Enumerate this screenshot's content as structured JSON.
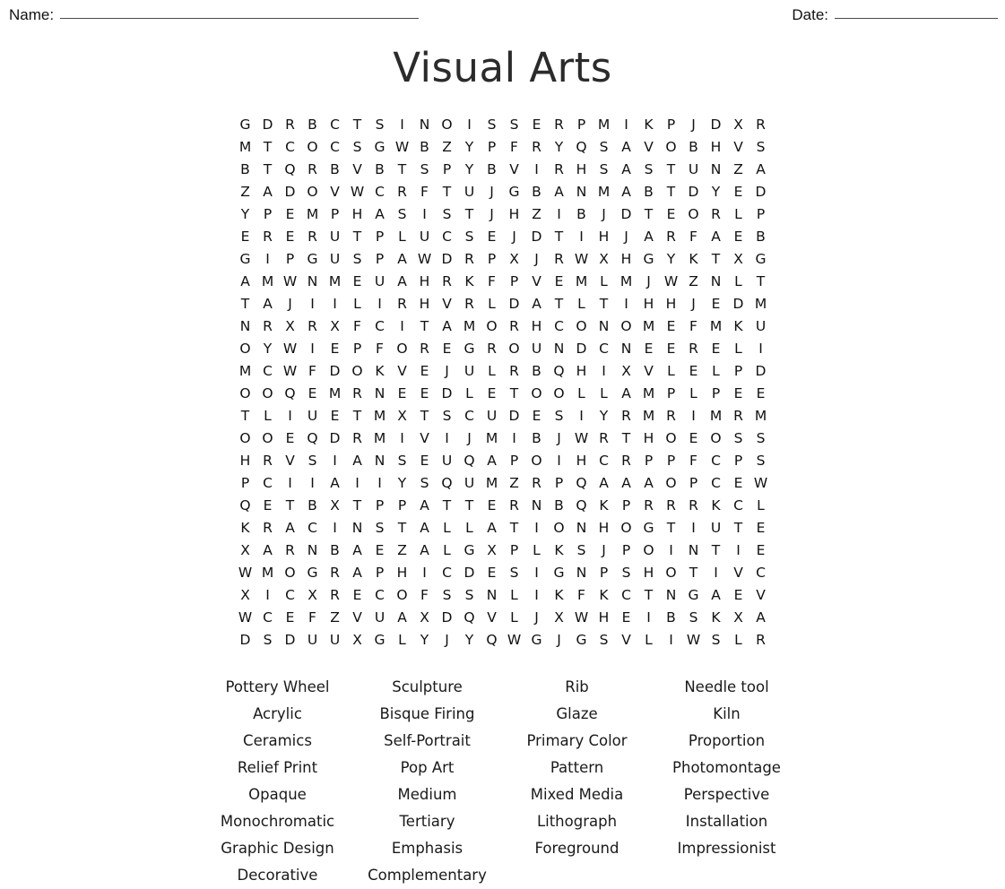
{
  "header": {
    "name_label": "Name:",
    "date_label": "Date:"
  },
  "title": "Visual Arts",
  "grid": {
    "columns": 24,
    "rows": 24,
    "letters": [
      [
        "G",
        "D",
        "R",
        "B",
        "C",
        "T",
        "S",
        "I",
        "N",
        "O",
        "I",
        "S",
        "S",
        "E",
        "R",
        "P",
        "M",
        "I",
        "K",
        "P",
        "J",
        "D",
        "X",
        "R"
      ],
      [
        "M",
        "T",
        "C",
        "O",
        "C",
        "S",
        "G",
        "W",
        "B",
        "Z",
        "Y",
        "P",
        "F",
        "R",
        "Y",
        "Q",
        "S",
        "A",
        "V",
        "O",
        "B",
        "H",
        "V",
        "S"
      ],
      [
        "B",
        "T",
        "Q",
        "R",
        "B",
        "V",
        "B",
        "T",
        "S",
        "P",
        "Y",
        "B",
        "V",
        "I",
        "R",
        "H",
        "S",
        "A",
        "S",
        "T",
        "U",
        "N",
        "Z",
        "A"
      ],
      [
        "Z",
        "A",
        "D",
        "O",
        "V",
        "W",
        "C",
        "R",
        "F",
        "T",
        "U",
        "J",
        "G",
        "B",
        "A",
        "N",
        "M",
        "A",
        "B",
        "T",
        "D",
        "Y",
        "E",
        "D"
      ],
      [
        "Y",
        "P",
        "E",
        "M",
        "P",
        "H",
        "A",
        "S",
        "I",
        "S",
        "T",
        "J",
        "H",
        "Z",
        "I",
        "B",
        "J",
        "D",
        "T",
        "E",
        "O",
        "R",
        "L",
        "P"
      ],
      [
        "E",
        "R",
        "E",
        "R",
        "U",
        "T",
        "P",
        "L",
        "U",
        "C",
        "S",
        "E",
        "J",
        "D",
        "T",
        "I",
        "H",
        "J",
        "A",
        "R",
        "F",
        "A",
        "E",
        "B"
      ],
      [
        "G",
        "I",
        "P",
        "G",
        "U",
        "S",
        "P",
        "A",
        "W",
        "D",
        "R",
        "P",
        "X",
        "J",
        "R",
        "W",
        "X",
        "H",
        "G",
        "Y",
        "K",
        "T",
        "X",
        "G"
      ],
      [
        "A",
        "M",
        "W",
        "N",
        "M",
        "E",
        "U",
        "A",
        "H",
        "R",
        "K",
        "F",
        "P",
        "V",
        "E",
        "M",
        "L",
        "M",
        "J",
        "W",
        "Z",
        "N",
        "L",
        "T"
      ],
      [
        "T",
        "A",
        "J",
        "I",
        "I",
        "L",
        "I",
        "R",
        "H",
        "V",
        "R",
        "L",
        "D",
        "A",
        "T",
        "L",
        "T",
        "I",
        "H",
        "H",
        "J",
        "E",
        "D",
        "M"
      ],
      [
        "N",
        "R",
        "X",
        "R",
        "X",
        "F",
        "C",
        "I",
        "T",
        "A",
        "M",
        "O",
        "R",
        "H",
        "C",
        "O",
        "N",
        "O",
        "M",
        "E",
        "F",
        "M",
        "K",
        "U"
      ],
      [
        "O",
        "Y",
        "W",
        "I",
        "E",
        "P",
        "F",
        "O",
        "R",
        "E",
        "G",
        "R",
        "O",
        "U",
        "N",
        "D",
        "C",
        "N",
        "E",
        "E",
        "R",
        "E",
        "L",
        "I"
      ],
      [
        "M",
        "C",
        "W",
        "F",
        "D",
        "O",
        "K",
        "V",
        "E",
        "J",
        "U",
        "L",
        "R",
        "B",
        "Q",
        "H",
        "I",
        "X",
        "V",
        "L",
        "E",
        "L",
        "P",
        "D"
      ],
      [
        "O",
        "O",
        "Q",
        "E",
        "M",
        "R",
        "N",
        "E",
        "E",
        "D",
        "L",
        "E",
        "T",
        "O",
        "O",
        "L",
        "L",
        "A",
        "M",
        "P",
        "L",
        "P",
        "E",
        "E"
      ],
      [
        "T",
        "L",
        "I",
        "U",
        "E",
        "T",
        "M",
        "X",
        "T",
        "S",
        "C",
        "U",
        "D",
        "E",
        "S",
        "I",
        "Y",
        "R",
        "M",
        "R",
        "I",
        "M",
        "R",
        "M"
      ],
      [
        "O",
        "O",
        "E",
        "Q",
        "D",
        "R",
        "M",
        "I",
        "V",
        "I",
        "J",
        "M",
        "I",
        "B",
        "J",
        "W",
        "R",
        "T",
        "H",
        "O",
        "E",
        "O",
        "S",
        "S"
      ],
      [
        "H",
        "R",
        "V",
        "S",
        "I",
        "A",
        "N",
        "S",
        "E",
        "U",
        "Q",
        "A",
        "P",
        "O",
        "I",
        "H",
        "C",
        "R",
        "P",
        "P",
        "F",
        "C",
        "P",
        "S"
      ],
      [
        "P",
        "C",
        "I",
        "I",
        "A",
        "I",
        "I",
        "Y",
        "S",
        "Q",
        "U",
        "M",
        "Z",
        "R",
        "P",
        "Q",
        "A",
        "A",
        "A",
        "O",
        "P",
        "C",
        "E",
        "W"
      ],
      [
        "Q",
        "E",
        "T",
        "B",
        "X",
        "T",
        "P",
        "P",
        "A",
        "T",
        "T",
        "E",
        "R",
        "N",
        "B",
        "Q",
        "K",
        "P",
        "R",
        "R",
        "R",
        "K",
        "C",
        "L"
      ],
      [
        "K",
        "R",
        "A",
        "C",
        "I",
        "N",
        "S",
        "T",
        "A",
        "L",
        "L",
        "A",
        "T",
        "I",
        "O",
        "N",
        "H",
        "O",
        "G",
        "T",
        "I",
        "U",
        "T",
        "E"
      ],
      [
        "X",
        "A",
        "R",
        "N",
        "B",
        "A",
        "E",
        "Z",
        "A",
        "L",
        "G",
        "X",
        "P",
        "L",
        "K",
        "S",
        "J",
        "P",
        "O",
        "I",
        "N",
        "T",
        "I",
        "E"
      ],
      [
        "W",
        "M",
        "O",
        "G",
        "R",
        "A",
        "P",
        "H",
        "I",
        "C",
        "D",
        "E",
        "S",
        "I",
        "G",
        "N",
        "P",
        "S",
        "H",
        "O",
        "T",
        "I",
        "V",
        "C"
      ],
      [
        "X",
        "I",
        "C",
        "X",
        "R",
        "E",
        "C",
        "O",
        "F",
        "S",
        "S",
        "N",
        "L",
        "I",
        "K",
        "F",
        "K",
        "C",
        "T",
        "N",
        "G",
        "A",
        "E",
        "V"
      ],
      [
        "W",
        "C",
        "E",
        "F",
        "Z",
        "V",
        "U",
        "A",
        "X",
        "D",
        "Q",
        "V",
        "L",
        "J",
        "X",
        "W",
        "H",
        "E",
        "I",
        "B",
        "S",
        "K",
        "X",
        "A"
      ],
      [
        "D",
        "S",
        "D",
        "U",
        "U",
        "X",
        "G",
        "L",
        "Y",
        "J",
        "Y",
        "Q",
        "W",
        "G",
        "J",
        "G",
        "S",
        "V",
        "L",
        "I",
        "W",
        "S",
        "L",
        "R"
      ]
    ]
  },
  "word_list": {
    "words": [
      "Pottery Wheel",
      "Sculpture",
      "Rib",
      "Needle tool",
      "Acrylic",
      "Bisque Firing",
      "Glaze",
      "Kiln",
      "Ceramics",
      "Self-Portrait",
      "Primary Color",
      "Proportion",
      "Relief Print",
      "Pop Art",
      "Pattern",
      "Photomontage",
      "Opaque",
      "Medium",
      "Mixed Media",
      "Perspective",
      "Monochromatic",
      "Tertiary",
      "Lithograph",
      "Installation",
      "Graphic Design",
      "Emphasis",
      "Foreground",
      "Impressionist",
      "Decorative",
      "Complementary",
      "",
      ""
    ]
  }
}
